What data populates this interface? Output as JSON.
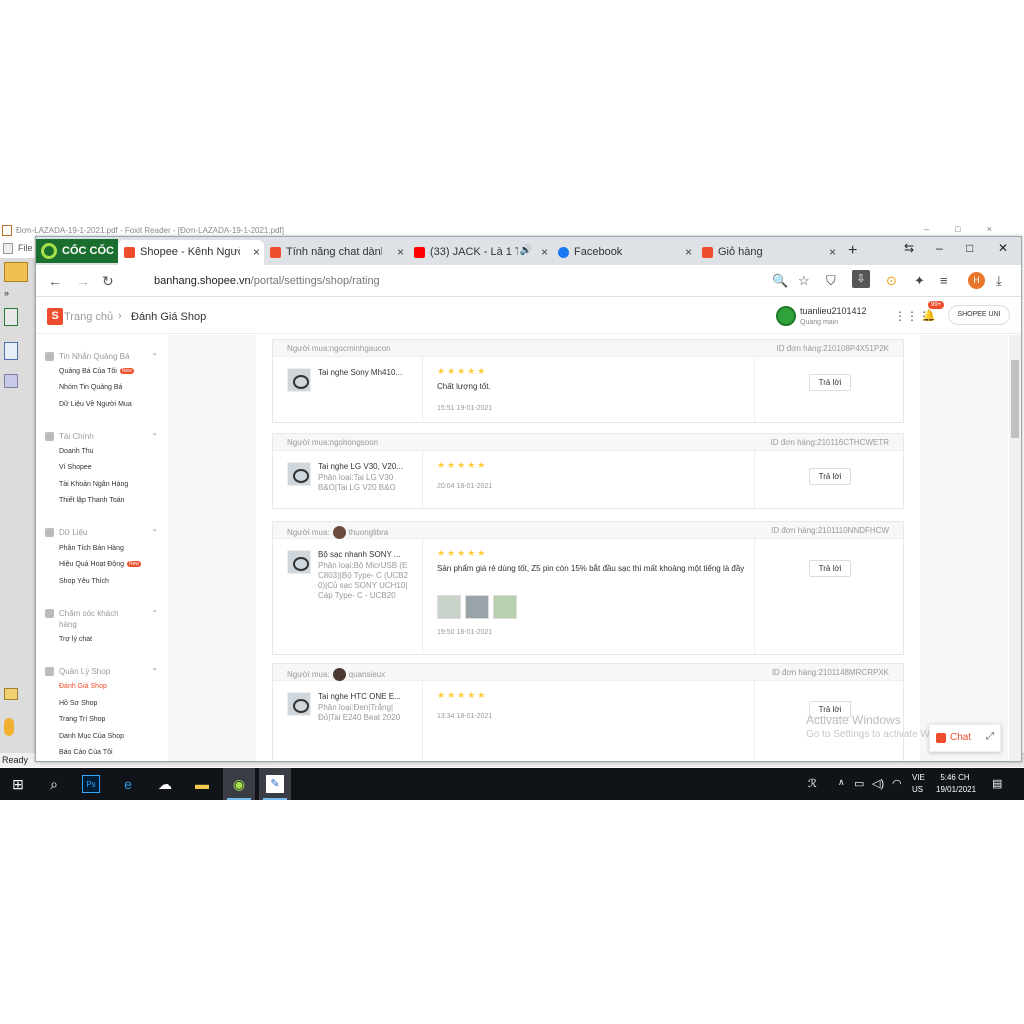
{
  "foxit": {
    "title": "Đơn-LAZADA-19-1-2021.pdf - Foxit Reader - [Đơn-LAZADA-19-1-2021.pdf]",
    "menu_file": "File",
    "status": "Ready"
  },
  "browser": {
    "brand": "CỐC CỐC",
    "tabs": [
      {
        "label": "Shopee - Kênh Người Bán",
        "icon": "shopee-icon"
      },
      {
        "label": "Tính năng chat dành cho",
        "icon": "shopee-icon"
      },
      {
        "label": "(33) JACK - Là 1 Thằng",
        "icon": "youtube-icon"
      },
      {
        "label": "Facebook",
        "icon": "facebook-icon"
      },
      {
        "label": "Giỏ hàng",
        "icon": "shopee-icon"
      }
    ],
    "url_domain": "banhang.shopee.vn",
    "url_path": "/portal/settings/shop/rating",
    "profile_initial": "H"
  },
  "header": {
    "home": "Trang chủ",
    "current": "Đánh Giá Shop",
    "username": "tuanlieu2101412",
    "user_sub": "Quang main",
    "notif_badge": "99+",
    "uni_button": "SHOPEE UNI"
  },
  "sidebar": {
    "sections": [
      {
        "title": "Tin Nhắn Quảng Bá",
        "items": [
          "Quảng Bá Của Tôi",
          "Nhóm Tin Quảng Bá",
          "Dữ Liệu Về Người Mua"
        ]
      },
      {
        "title": "Tài Chính",
        "items": [
          "Doanh Thu",
          "Ví Shopee",
          "Tài Khoản Ngân Hàng",
          "Thiết lập Thanh Toán"
        ]
      },
      {
        "title": "Dữ Liệu",
        "items": [
          "Phân Tích Bán Hàng",
          "Hiệu Quả Hoạt Động",
          "Shop Yêu Thích"
        ]
      },
      {
        "title": "Chăm sóc khách hàng",
        "items": [
          "Trợ lý chat"
        ]
      },
      {
        "title": "Quản Lý Shop",
        "items": [
          "Đánh Giá Shop",
          "Hồ Sơ Shop",
          "Trang Trí Shop",
          "Danh Mục Của Shop",
          "Báo Cáo Của Tôi"
        ]
      }
    ],
    "new_label": "New"
  },
  "reviews": [
    {
      "buyer_label": "Người mua:",
      "buyer": "ngocminhgaucon",
      "order_label": "ID đơn hàng:",
      "order_id": "210108P4X51P2K",
      "product": "Tai nghe Sony Mh410...",
      "variant": "",
      "stars": "★★★★★",
      "rating": 5,
      "text": "Chất lượng tốt.",
      "time": "15:51 19-01-2021",
      "reply": "Trả lời"
    },
    {
      "buyer_label": "Người mua:",
      "buyer": "ngohongsoon",
      "order_label": "ID đơn hàng:",
      "order_id": "210116CTHCWETR",
      "product": "Tai nghe LG V30, V20...",
      "variant": "Phân loại:Tai LG V30 B&O|Tai LG V20 B&O",
      "stars": "★★★★★",
      "rating": 5,
      "text": "",
      "time": "20:04 18-01-2021",
      "reply": "Trả lời"
    },
    {
      "buyer_label": "Người mua:",
      "buyer": "thuonglibra",
      "order_label": "ID đơn hàng:",
      "order_id": "2101110NNDFHCW",
      "product": "Bộ sạc nhanh SONY ...",
      "variant": "Phân loại:Bộ MicrUSB (EC803)|Bộ Type- C (UCB20)|Củ sạc SONY UCH10|Cáp Type- C - UCB20",
      "stars": "★★★★★",
      "rating": 5,
      "text": "Sản phẩm giá rẻ dùng tốt, Z5 pin còn 15% bắt đầu sạc thì mất khoảng một tiếng là đầy",
      "time": "19:50 18-01-2021",
      "reply": "Trả lời"
    },
    {
      "buyer_label": "Người mua:",
      "buyer": "quansieux",
      "order_label": "ID đơn hàng:",
      "order_id": "2101148MRCRPXK",
      "product": "Tai nghe HTC ONE E...",
      "variant": "Phân loại:Đen|Trắng|Đỏ|Tai E240 Beat 2020",
      "stars": "★★★★★",
      "rating": 5,
      "text": "",
      "time": "13:34 18-01-2021",
      "reply": "Trả lời"
    }
  ],
  "watermark": {
    "line1": "Activate Windows",
    "line2": "Go to Settings to activate Windows."
  },
  "chat_label": "Chat",
  "taskbar": {
    "lang_line1": "VIE",
    "lang_line2": "US",
    "time": "5:46 CH",
    "date": "19/01/2021"
  },
  "colors": {
    "shopee_orange": "#ee4d2d",
    "star": "#ffce3d",
    "coccoc_green": "#1a6e2e"
  }
}
